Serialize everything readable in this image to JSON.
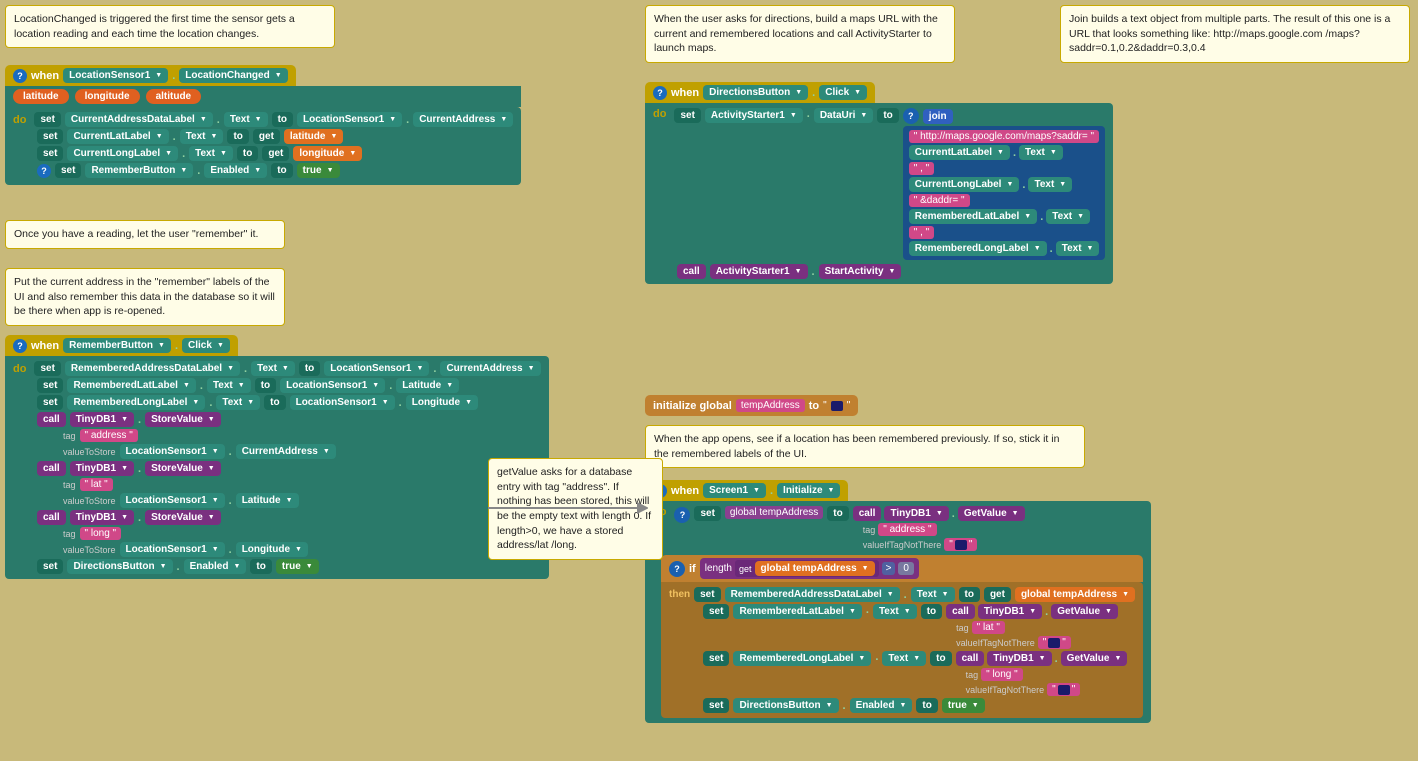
{
  "comments": {
    "c1": "LocationChanged is triggered the first time the sensor gets a location\nreading and each time the location changes.",
    "c2": "Once you have a reading, let the user \"remember\" it.",
    "c3": "Put the current address in the \"remember\" labels of the\nUI and also remember this data in the database so it\nwill be there when app is re-opened.",
    "c4": "When the user asks for directions, build a maps URL\nwith the current and remembered locations and call\nActivityStarter to launch maps.",
    "c5": "Join builds a text object from multiple parts.\nThe result of this one is a URL that looks\nsomething like: http://maps.google.com\n/maps?saddr=0.1,0.2&daddr=0.3,0.4",
    "c6": "getValue asks for a\ndatabase entry with\ntag \"address\". If\nnothing has been\nstored, this will\nbe the empty text\nwith length 0. If\nlength>0, we have a\nstored address/lat\n/long.",
    "c7": "When the app opens, see if a location has been remembered previously.\nIf so, stick it in the remembered labels of the UI."
  },
  "blocks": {
    "when1": {
      "event": "when",
      "component": "LocationSensor1",
      "event_name": "LocationChanged",
      "params": [
        "latitude",
        "longitude",
        "altitude"
      ]
    },
    "when2": {
      "event": "when",
      "component": "RememberButton",
      "event_name": "Click"
    },
    "when3": {
      "event": "when",
      "component": "DirectionsButton",
      "event_name": "Click"
    },
    "when4": {
      "event": "when",
      "component": "Screen1",
      "event_name": "Initialize"
    }
  },
  "labels": {
    "do": "do",
    "set": "set",
    "to": "to",
    "get": "get",
    "call": "call",
    "if": "if",
    "then": "then",
    "initialize_global": "initialize global",
    "tag": "tag",
    "valueToStore": "valueToStore",
    "valueIfTagNotThere": "valueIfTagNotThere",
    "join": "join",
    "length": "length",
    "true": "true",
    "Text": "Text",
    "Enabled": "Enabled",
    "DataUri": "DataUri",
    "CurrentAddress": "CurrentAddress",
    "Latitude": "Latitude",
    "Longitude": "Longitude",
    "StartActivity": ".StartActivity",
    "GetValue": ".GetValue",
    "StoreValue": ".StoreValue"
  },
  "colors": {
    "canvas_bg": "#c8b97a",
    "comment_bg": "#fffde7",
    "comment_border": "#c8a900",
    "event_header": "#c0a000",
    "teal_body": "#2a7a6a",
    "purple_body": "#6a2878",
    "magenta": "#c03070"
  }
}
